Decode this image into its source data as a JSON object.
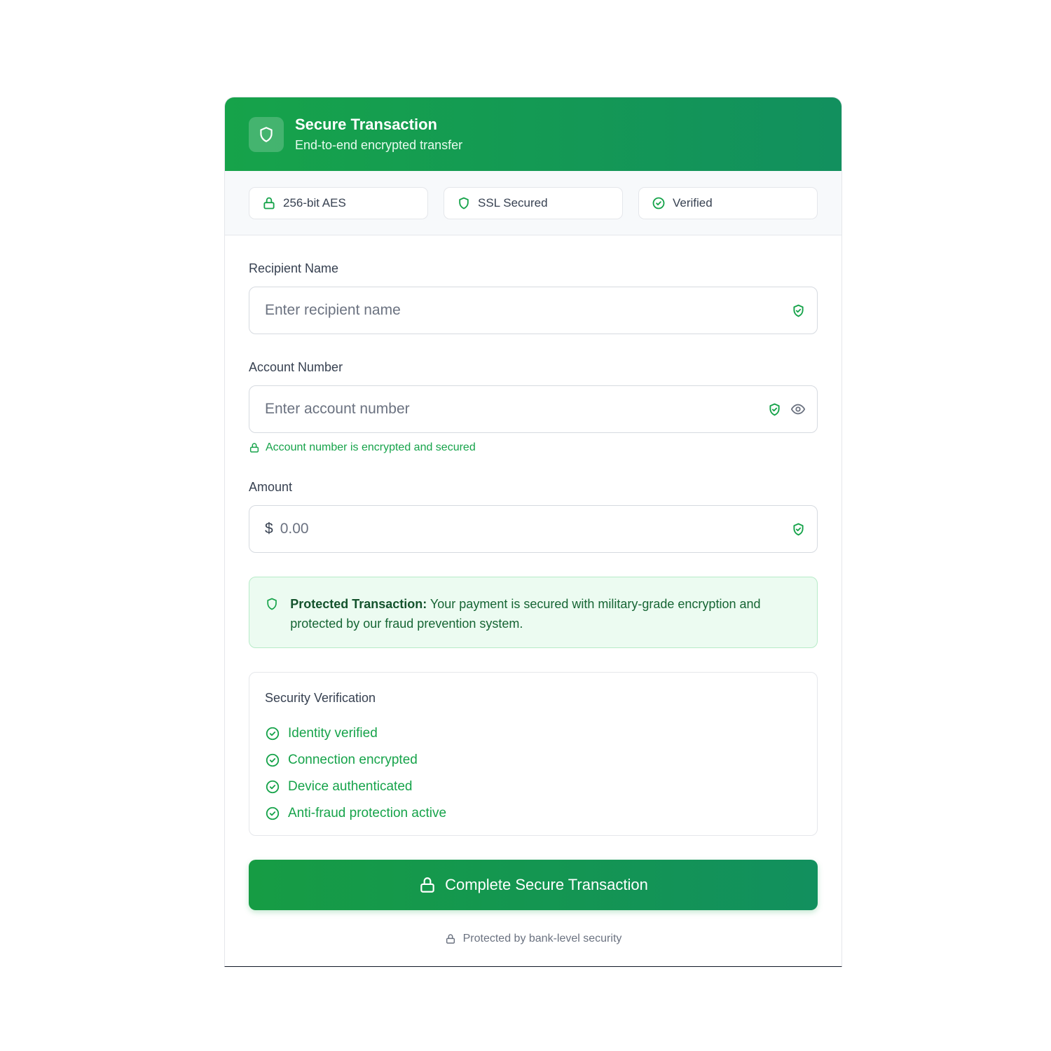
{
  "header": {
    "title": "Secure Transaction",
    "subtitle": "End-to-end encrypted transfer",
    "icon": "shield-icon"
  },
  "badges": [
    {
      "label": "256-bit AES",
      "icon": "lock-icon"
    },
    {
      "label": "SSL Secured",
      "icon": "shield-icon"
    },
    {
      "label": "Verified",
      "icon": "check-circle-icon"
    }
  ],
  "form": {
    "recipient": {
      "label": "Recipient Name",
      "placeholder": "Enter recipient name",
      "value": ""
    },
    "account": {
      "label": "Account Number",
      "placeholder": "Enter account number",
      "value": "",
      "hint": "Account number is encrypted and secured"
    },
    "amount": {
      "label": "Amount",
      "currency": "$",
      "placeholder": "0.00",
      "value": ""
    }
  },
  "notice": {
    "title": "Protected Transaction:",
    "text": " Your payment is secured with military-grade encryption and protected by our fraud prevention system."
  },
  "verification": {
    "title": "Security Verification",
    "items": [
      "Identity verified",
      "Connection encrypted",
      "Device authenticated",
      "Anti-fraud protection active"
    ]
  },
  "submit_label": "Complete Secure Transaction",
  "footer_text": "Protected by bank-level security",
  "colors": {
    "accent": "#16a34a",
    "accent_dark": "#12905e",
    "notice_bg": "#ecfbf1"
  }
}
